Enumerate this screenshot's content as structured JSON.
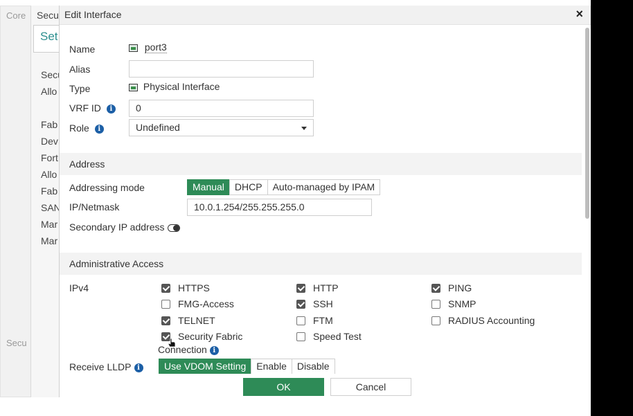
{
  "background": {
    "outer_title": "Core",
    "panel_title": "Secu",
    "tab_label": "Set",
    "items": [
      "Secu",
      "Allo",
      "",
      "Fab",
      "Dev",
      "Fort",
      "Allo",
      "Fab",
      "SAN",
      "Mar",
      "Mar"
    ],
    "left_bottom": "Secu"
  },
  "dialog": {
    "title": "Edit Interface",
    "close": "×"
  },
  "form": {
    "name_label": "Name",
    "name_value": "port3",
    "alias_label": "Alias",
    "alias_value": "",
    "type_label": "Type",
    "type_value": "Physical Interface",
    "vrf_label": "VRF ID",
    "vrf_value": "0",
    "role_label": "Role",
    "role_value": "Undefined"
  },
  "address": {
    "section_title": "Address",
    "mode_label": "Addressing mode",
    "modes": [
      "Manual",
      "DHCP",
      "Auto-managed by IPAM"
    ],
    "active_mode": "Manual",
    "ip_label": "IP/Netmask",
    "ip_value": "10.0.1.254/255.255.255.0",
    "secondary_label": "Secondary IP address"
  },
  "admin": {
    "section_title": "Administrative Access",
    "ipv4_label": "IPv4",
    "col1": [
      {
        "label": "HTTPS",
        "checked": true
      },
      {
        "label": "FMG-Access",
        "checked": false
      },
      {
        "label": "TELNET",
        "checked": true
      },
      {
        "label": "Security Fabric",
        "checked": true
      }
    ],
    "col1_connection": "Connection",
    "col2": [
      {
        "label": "HTTP",
        "checked": true
      },
      {
        "label": "SSH",
        "checked": true
      },
      {
        "label": "FTM",
        "checked": false
      },
      {
        "label": "Speed Test",
        "checked": false
      }
    ],
    "col3": [
      {
        "label": "PING",
        "checked": true
      },
      {
        "label": "SNMP",
        "checked": false
      },
      {
        "label": "RADIUS Accounting",
        "checked": false
      }
    ]
  },
  "lldp": {
    "label": "Receive LLDP",
    "options": [
      "Use VDOM Setting",
      "Enable",
      "Disable"
    ],
    "active": "Use VDOM Setting"
  },
  "footer": {
    "ok": "OK",
    "cancel": "Cancel"
  }
}
